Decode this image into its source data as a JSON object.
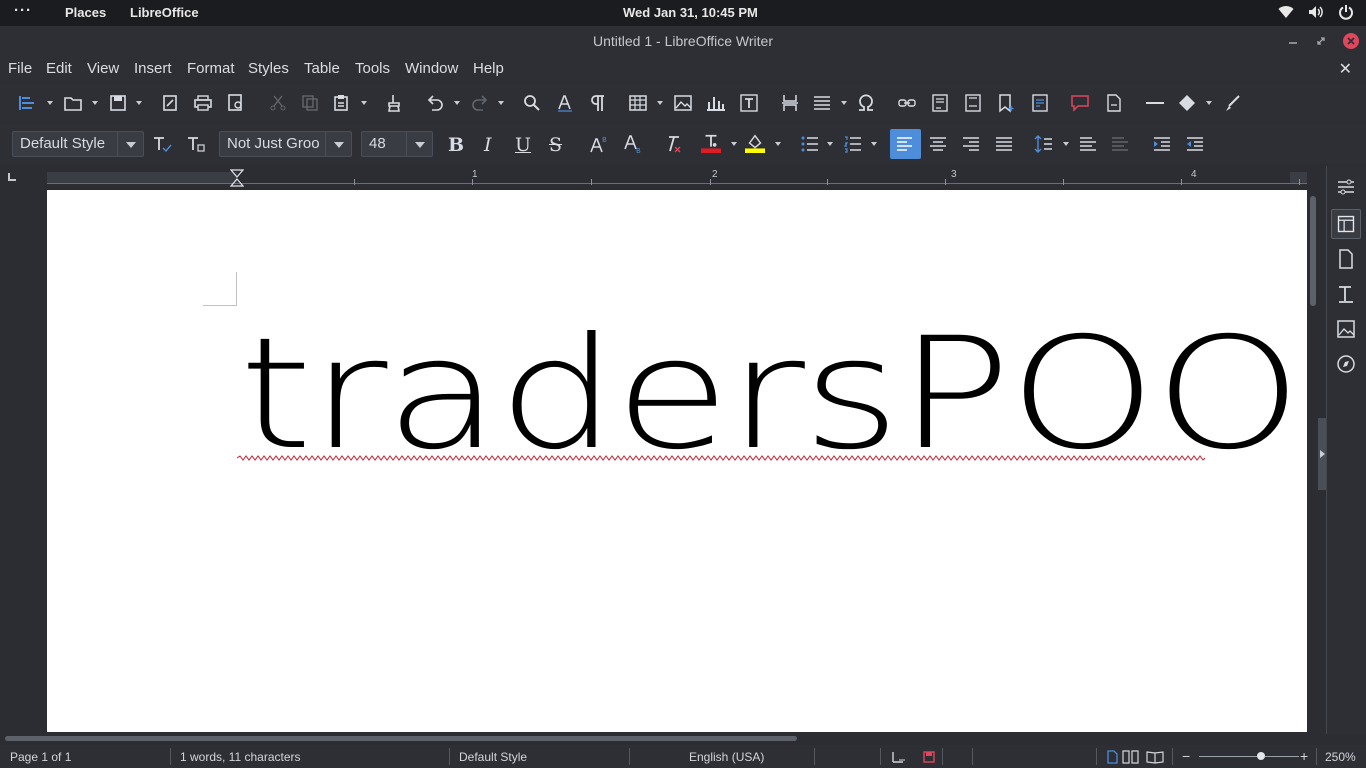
{
  "topbar": {
    "activities": "···",
    "places": "Places",
    "app_name": "LibreOffice",
    "clock": "Wed Jan 31, 10:45 PM",
    "tray_icons": [
      "wifi-icon",
      "volume-icon",
      "power-icon"
    ]
  },
  "window": {
    "title": "Untitled 1 - LibreOffice Writer"
  },
  "menu": {
    "items": [
      "File",
      "Edit",
      "View",
      "Insert",
      "Format",
      "Styles",
      "Table",
      "Tools",
      "Window",
      "Help"
    ],
    "close_doc": "✕"
  },
  "format_bar": {
    "paragraph_style": "Default Style",
    "font_name": "Not Just Groo",
    "font_size": "48",
    "bold": "B",
    "italic": "I",
    "underline": "U",
    "strike": "S",
    "highlight_color": "#ffff00",
    "font_color": "#e01b24"
  },
  "ruler": {
    "labels": [
      "1",
      "2",
      "3",
      "4"
    ]
  },
  "document": {
    "text": "tradersPOOL"
  },
  "status": {
    "page": "Page 1 of 1",
    "words": "1 words, 11 characters",
    "page_style": "Default Style",
    "language": "English (USA)",
    "zoom": "250%",
    "zoom_minus": "−",
    "zoom_plus": "+"
  },
  "colors": {
    "accent": "#4d8dd9",
    "close": "#e0475d"
  }
}
